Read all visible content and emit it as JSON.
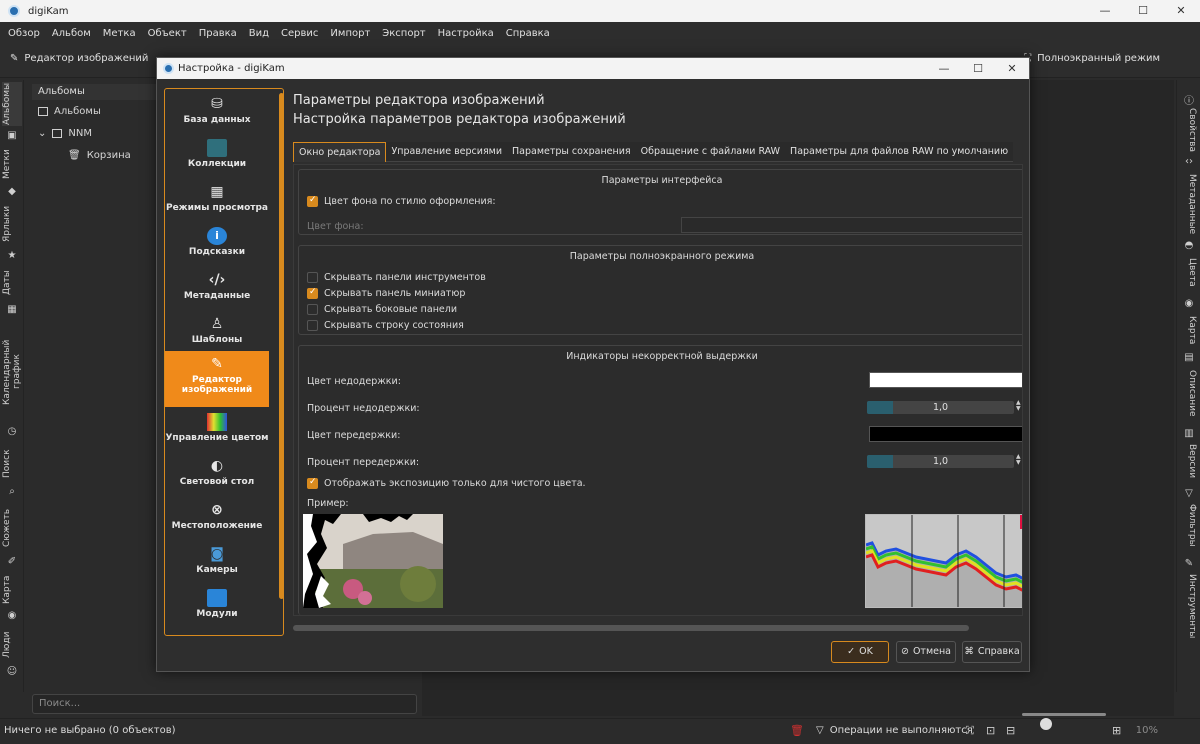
{
  "window": {
    "title": "digiKam",
    "controls": [
      "—",
      "☐",
      "✕"
    ]
  },
  "menu": [
    "Обзор",
    "Альбом",
    "Метка",
    "Объект",
    "Правка",
    "Вид",
    "Сервис",
    "Импорт",
    "Экспорт",
    "Настройка",
    "Справка"
  ],
  "toolbar": {
    "editor_label": "Редактор изображений",
    "fullscreen_label": "Полноэкранный режим"
  },
  "left_tabs": [
    "Альбомы",
    "Метки",
    "Ярлыки",
    "Даты",
    "Календарный график",
    "Поиск",
    "Сюжеть",
    "Карта",
    "Люди"
  ],
  "right_tabs": [
    "Свойства",
    "Метаданные",
    "Цвета",
    "Карта",
    "Описание",
    "Версии",
    "Фильтры",
    "Инструменты"
  ],
  "albums": {
    "header": "Альбомы",
    "items": [
      "Альбомы",
      "NNM",
      "Корзина"
    ],
    "search_placeholder": "Поиск..."
  },
  "status": {
    "selection": "Ничего не выбрано (0 объектов)",
    "operations": "Операции не выполняются",
    "zoom": "10%"
  },
  "dialog": {
    "title": "Настройка - digiKam",
    "controls": [
      "—",
      "☐",
      "✕"
    ],
    "categories": [
      {
        "label": "База данных",
        "icon": "database-icon"
      },
      {
        "label": "Коллекции",
        "icon": "collections-icon"
      },
      {
        "label": "Режимы просмотра",
        "icon": "view-modes-icon"
      },
      {
        "label": "Подсказки",
        "icon": "info-icon"
      },
      {
        "label": "Метаданные",
        "icon": "code-icon"
      },
      {
        "label": "Шаблоны",
        "icon": "user-icon"
      },
      {
        "label": "Редактор изображений",
        "icon": "pencil-icon"
      },
      {
        "label": "Управление цветом",
        "icon": "color-icon"
      },
      {
        "label": "Световой стол",
        "icon": "light-table-icon"
      },
      {
        "label": "Местоположение",
        "icon": "location-icon"
      },
      {
        "label": "Камеры",
        "icon": "camera-icon"
      },
      {
        "label": "Модули",
        "icon": "plugins-icon"
      }
    ],
    "heading": "Параметры редактора изображений",
    "subheading": "Настройка параметров редактора изображений",
    "tabs": [
      "Окно редактора",
      "Управление версиями",
      "Параметры сохранения",
      "Обращение с файлами RAW",
      "Параметры для файлов RAW по умолчанию"
    ],
    "interface": {
      "title": "Параметры интерфейса",
      "theme_bg_label": "Цвет фона по стилю оформления:",
      "bg_color_label": "Цвет фона:"
    },
    "fullscreen": {
      "title": "Параметры полноэкранного режима",
      "options": [
        {
          "label": "Скрывать панели инструментов",
          "checked": false
        },
        {
          "label": "Скрывать панель миниатюр",
          "checked": true
        },
        {
          "label": "Скрывать боковые панели",
          "checked": false
        },
        {
          "label": "Скрывать строку состояния",
          "checked": false
        }
      ]
    },
    "exposure": {
      "title": "Индикаторы некорректной выдержки",
      "under_color_label": "Цвет недодержки:",
      "under_color": "#ffffff",
      "under_pct_label": "Процент недодержки:",
      "under_pct": "1,0",
      "over_color_label": "Цвет передержки:",
      "over_color": "#000000",
      "over_pct_label": "Процент передержки:",
      "over_pct": "1,0",
      "pure_label": "Отображать экспозицию только для чистого цвета.",
      "example_label": "Пример:"
    },
    "buttons": {
      "ok": "OK",
      "cancel": "Отмена",
      "help": "Справка"
    }
  },
  "colors": {
    "accent": "#d88a1e",
    "active_category": "#f08a1a",
    "spin_fill": "#2a5f6e"
  }
}
